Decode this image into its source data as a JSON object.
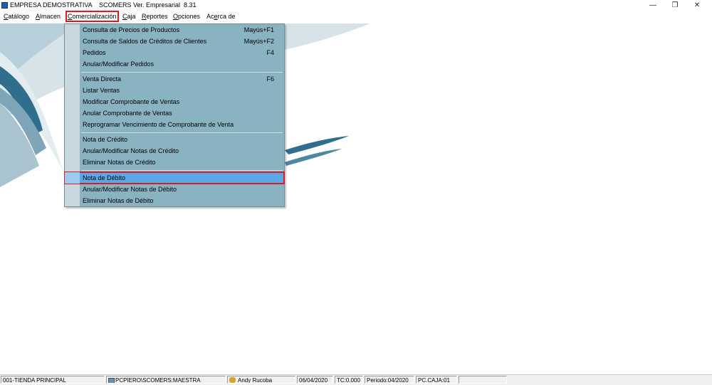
{
  "window": {
    "company": "EMPRESA DEMOSTRATIVA",
    "app_title": "SCOMERS Ver. Empresarial  8.31",
    "minimize": "—",
    "restore": "❐",
    "close": "✕"
  },
  "menubar": {
    "items": [
      {
        "pre": "",
        "u": "C",
        "post": "atálogo"
      },
      {
        "pre": "",
        "u": "A",
        "post": "lmacen"
      },
      {
        "pre": "",
        "u": "C",
        "post": "omercialización"
      },
      {
        "pre": "",
        "u": "C",
        "post": "aja"
      },
      {
        "pre": "",
        "u": "R",
        "post": "eportes"
      },
      {
        "pre": "",
        "u": "O",
        "post": "pciones"
      },
      {
        "pre": "Ac",
        "u": "e",
        "post": "rca de"
      }
    ]
  },
  "dropdown": {
    "items": [
      {
        "label": "Consulta de Precios de Productos",
        "shortcut": "Mayús+F1"
      },
      {
        "label": "Consulta de Saldos de Créditos de Clientes",
        "shortcut": "Mayús+F2"
      },
      {
        "label": "Pedidos",
        "shortcut": "F4"
      },
      {
        "label": "Anular/Modificar Pedidos",
        "shortcut": ""
      },
      {
        "label": "Venta Directa",
        "shortcut": "F6"
      },
      {
        "label": "Listar Ventas",
        "shortcut": ""
      },
      {
        "label": "Modificar Comprobante de Ventas",
        "shortcut": ""
      },
      {
        "label": "Anular Comprobante de Ventas",
        "shortcut": ""
      },
      {
        "label": "Reprogramar Vencimiento de Comprobante de Venta",
        "shortcut": ""
      },
      {
        "label": "Nota de Crédito",
        "shortcut": ""
      },
      {
        "label": "Anular/Modificar Notas de Crédito",
        "shortcut": ""
      },
      {
        "label": "Eliminar Notas de Crédito",
        "shortcut": ""
      },
      {
        "label": "Nota de Débito",
        "shortcut": ""
      },
      {
        "label": "Anular/Modificar Notas de Débito",
        "shortcut": ""
      },
      {
        "label": "Eliminar Notas de Débito",
        "shortcut": ""
      }
    ]
  },
  "statusbar": {
    "store": "001-TIENDA PRINCIPAL",
    "db": "PCPIERO\\SCOMERS:MAESTRA",
    "user": "Andy Rucoba",
    "date": "06/04/2020",
    "tc": "TC:0.000",
    "period": "Periodo:04/2020",
    "pc": "PC.CAJA:01"
  },
  "colors": {
    "menu_bg": "#8ab3c2",
    "highlight": "#5aa8e6",
    "focus_outline": "#e01822",
    "wallpaper_dark": "#2f6f8d",
    "wallpaper_light": "#c9dbe4"
  }
}
